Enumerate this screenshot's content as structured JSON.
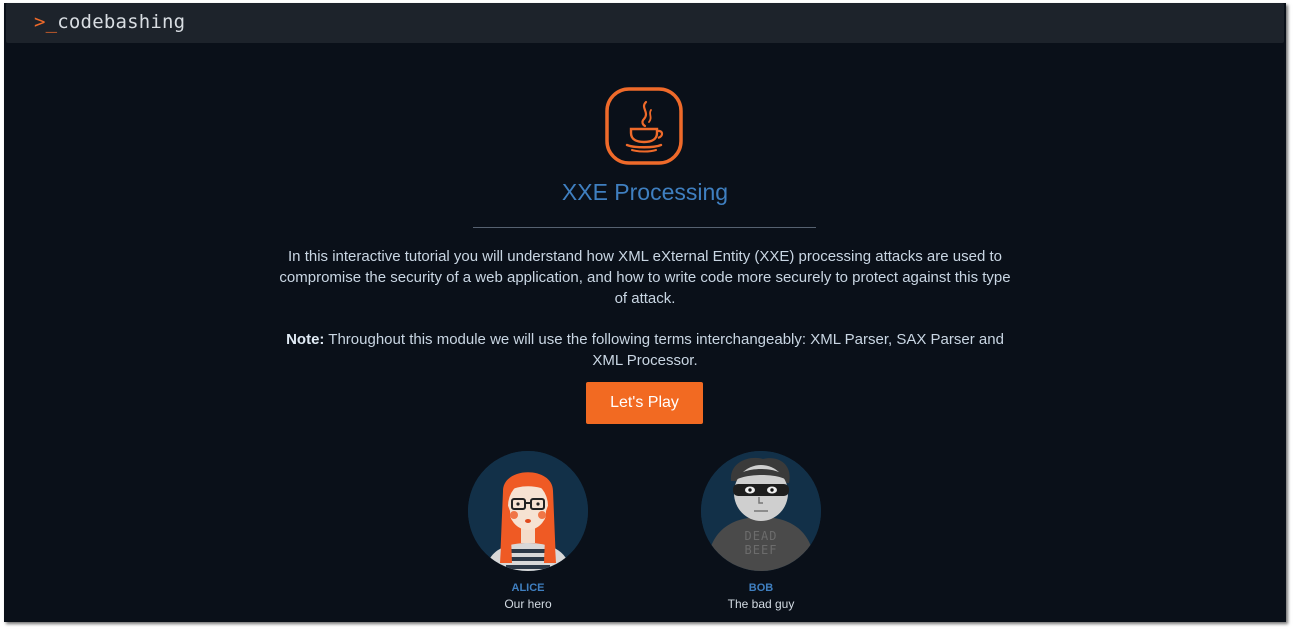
{
  "header": {
    "logo_prompt": ">_",
    "logo_text": "codebashing"
  },
  "module": {
    "icon": "java-coffee-icon",
    "title": "XXE Processing",
    "intro": "In this interactive tutorial you will understand how XML eXternal Entity (XXE) processing attacks are used to compromise the security of a web application, and how to write code more securely to protect against this type of attack.",
    "note_label": "Note:",
    "note_text": " Throughout this module we will use the following terms interchangeably: XML Parser, SAX Parser and XML Processor.",
    "play_label": "Let's Play"
  },
  "characters": [
    {
      "name": "ALICE",
      "role": "Our hero"
    },
    {
      "name": "BOB",
      "role": "The bad guy",
      "shirt_text": "DEAD BEEF"
    }
  ],
  "colors": {
    "background": "#0a1019",
    "topbar": "#1d232b",
    "accent": "#f26a22",
    "title_blue": "#3f7fc0"
  }
}
